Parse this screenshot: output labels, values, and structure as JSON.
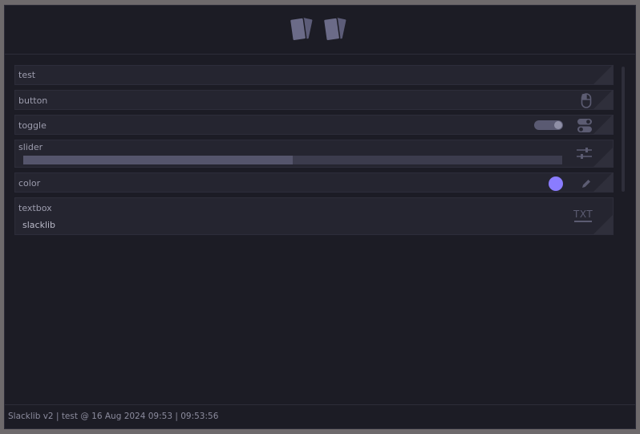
{
  "header": {
    "tabs": [
      {
        "icon": "cards-icon"
      },
      {
        "icon": "cards-icon"
      }
    ]
  },
  "rows": {
    "test": {
      "label": "test"
    },
    "button": {
      "label": "button",
      "icon": "mouse-icon"
    },
    "toggle": {
      "label": "toggle",
      "value": true,
      "icon": "toggle-icon"
    },
    "slider": {
      "label": "slider",
      "value_fraction": 0.5,
      "icon": "sliders-icon"
    },
    "color": {
      "label": "color",
      "value": "#8a7cff",
      "icon": "pencil-icon"
    },
    "textbox": {
      "label": "textbox",
      "value": "slacklib",
      "icon_text": "TXT"
    }
  },
  "footer": {
    "text": "Slacklib v2 | test @ 16 Aug 2024 09:53 | 09:53:56"
  },
  "colors": {
    "window_bg": "#1c1c25",
    "row_bg": "#252530",
    "accent": "#8a7cff"
  }
}
